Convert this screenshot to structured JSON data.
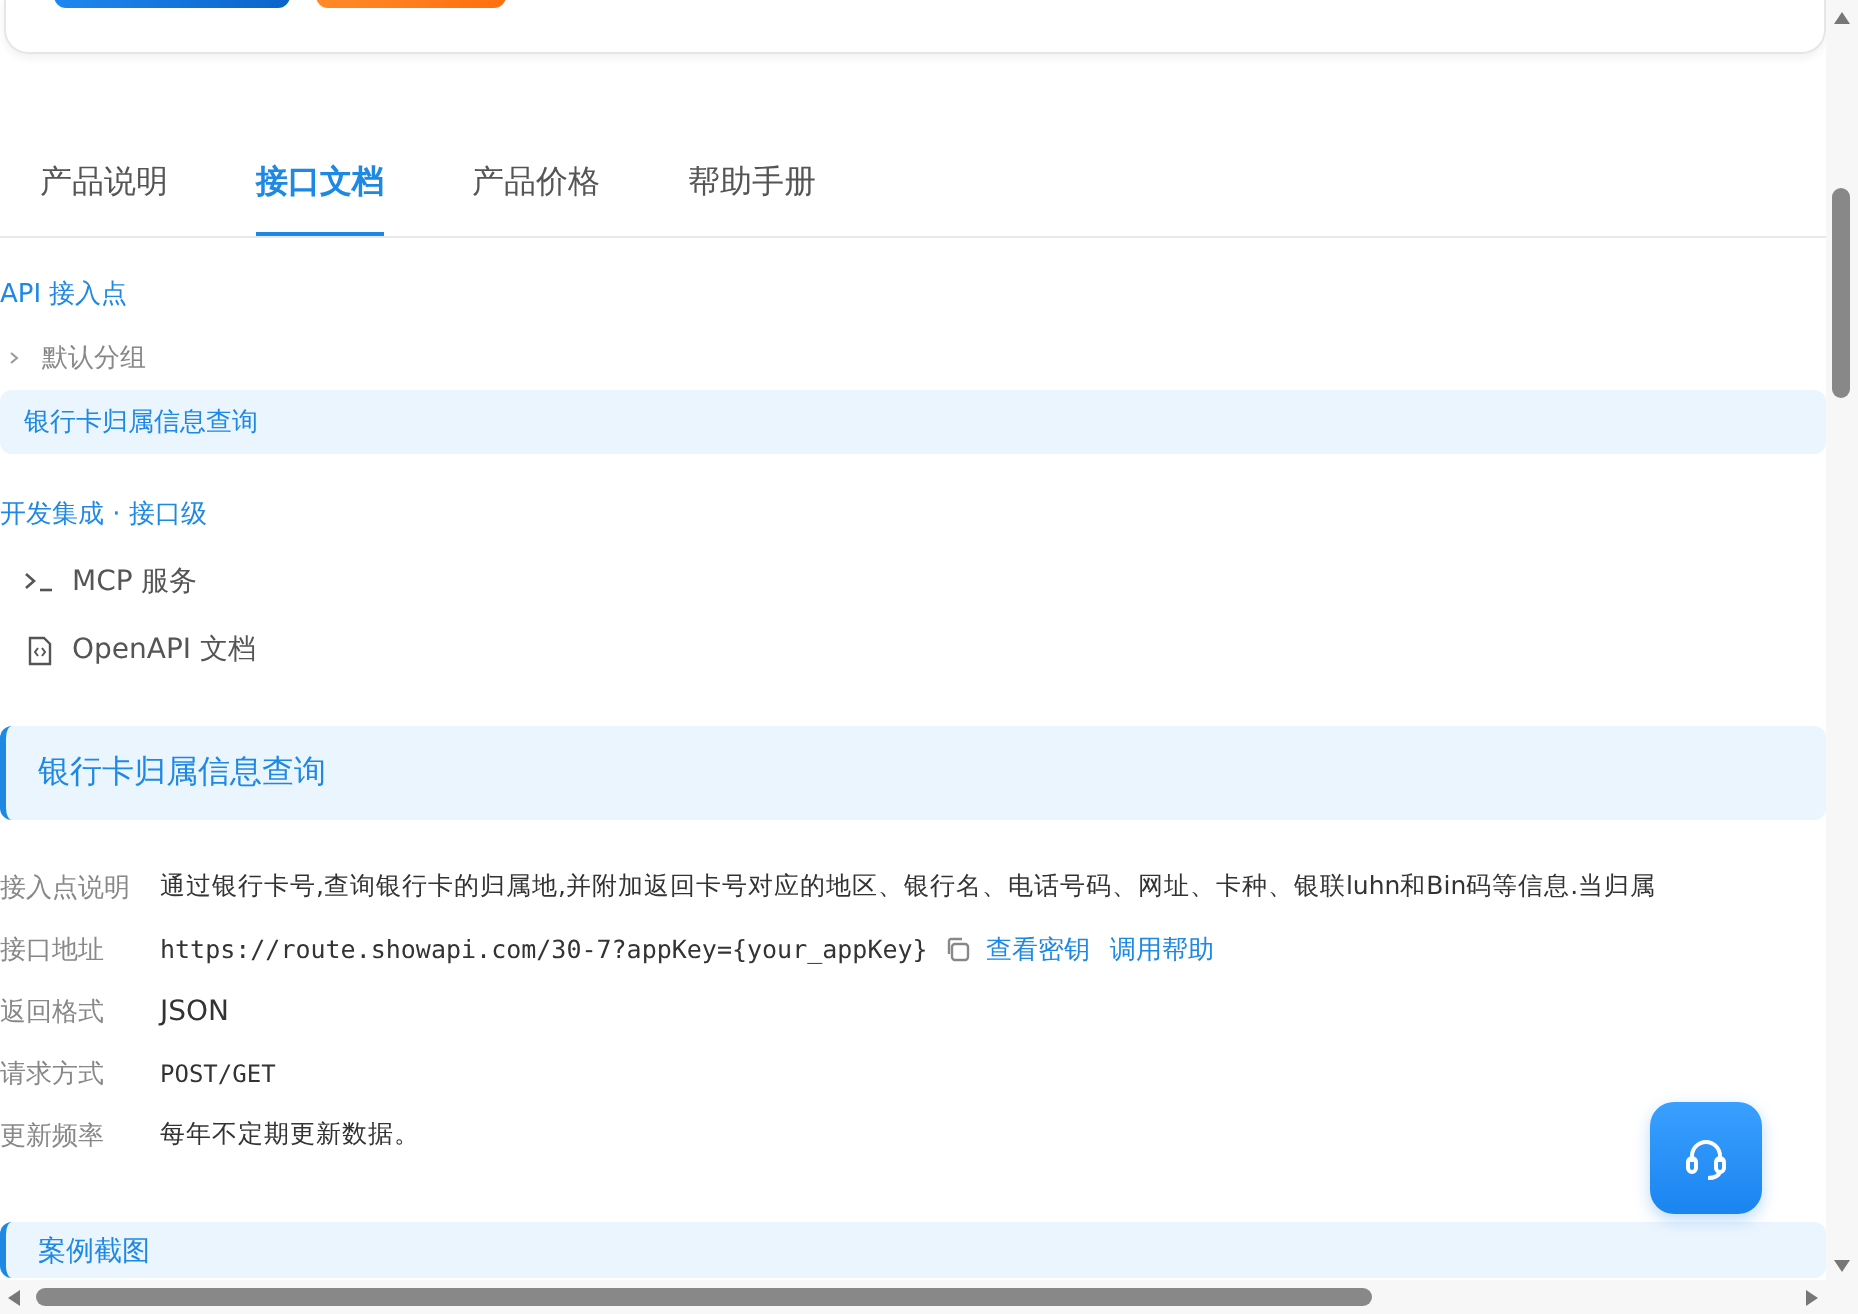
{
  "tabs": [
    {
      "label": "产品说明",
      "selected": false
    },
    {
      "label": "接口文档",
      "selected": true
    },
    {
      "label": "产品价格",
      "selected": false
    },
    {
      "label": "帮助手册",
      "selected": false
    }
  ],
  "api_section": {
    "title": "API 接入点",
    "group": {
      "label": "默认分组",
      "expanded": false
    },
    "items": [
      {
        "label": "银行卡归属信息查询",
        "selected": true
      }
    ]
  },
  "dev_section": {
    "title": "开发集成 · 接口级",
    "items": [
      {
        "kind": "terminal",
        "label": "MCP 服务"
      },
      {
        "kind": "file",
        "label": "OpenAPI 文档"
      }
    ]
  },
  "detail": {
    "title": "银行卡归属信息查询",
    "rows": [
      {
        "kind": "text",
        "label": "接入点说明",
        "value": "通过银行卡号,查询银行卡的归属地,并附加返回卡号对应的地区、银行名、电话号码、网址、卡种、银联luhn和Bin码等信息.当归属"
      },
      {
        "kind": "url",
        "label": "接口地址",
        "value": "https://route.showapi.com/30-7?appKey={your_appKey}",
        "links": [
          "查看密钥",
          "调用帮助"
        ]
      },
      {
        "kind": "large",
        "label": "返回格式",
        "value": "JSON"
      },
      {
        "kind": "mono",
        "label": "请求方式",
        "value": "POST/GET"
      },
      {
        "kind": "text",
        "label": "更新频率",
        "value": "每年不定期更新数据。"
      }
    ]
  },
  "next_section": {
    "title": "案例截图"
  }
}
